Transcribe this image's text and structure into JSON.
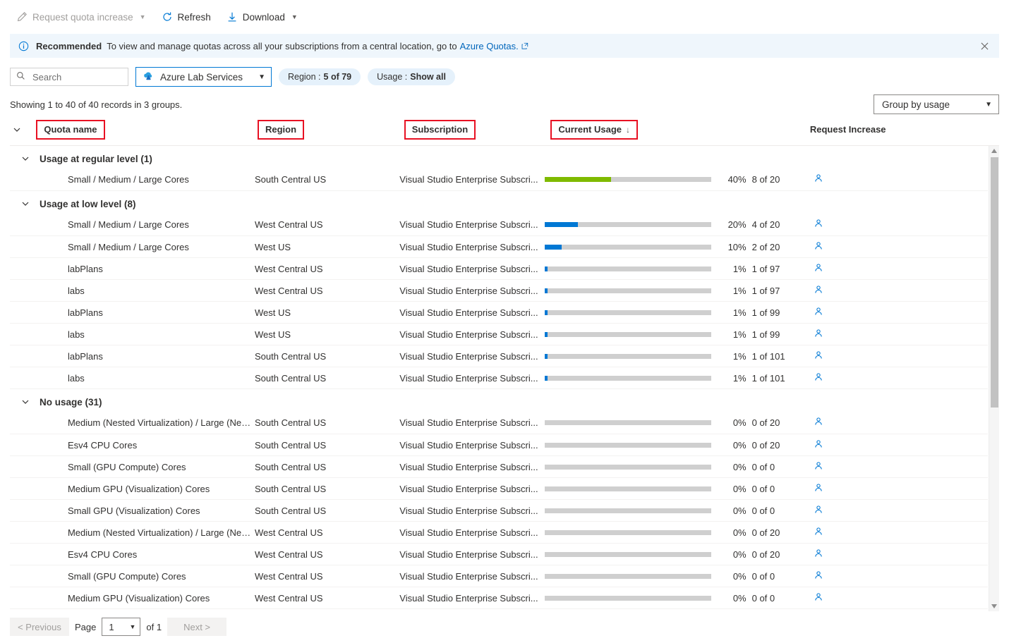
{
  "toolbar": {
    "request_quota_increase": "Request quota increase",
    "refresh": "Refresh",
    "download": "Download"
  },
  "banner": {
    "label": "Recommended",
    "text": "To view and manage quotas across all your subscriptions from a central location, go to",
    "link": "Azure Quotas."
  },
  "filters": {
    "search_placeholder": "Search",
    "search_value": "",
    "provider": "Azure Lab Services",
    "region_pill_label": "Region :",
    "region_pill_value": "5 of 79",
    "usage_pill_label": "Usage :",
    "usage_pill_value": "Show all"
  },
  "summary": {
    "showing": "Showing 1 to 40 of 40 records in 3 groups.",
    "group_by": "Group by usage"
  },
  "columns": {
    "quota_name": "Quota name",
    "region": "Region",
    "subscription": "Subscription",
    "current_usage": "Current Usage",
    "sort_arrow": "↓",
    "request_increase": "Request Increase"
  },
  "colors": {
    "accent": "#0078d4",
    "green": "#7fba00",
    "blue_bar": "#0078d4",
    "track": "#cfcfcf",
    "highlight_box": "#e81123",
    "banner_bg": "#eff6fc",
    "pill_bg": "#e5f1fb"
  },
  "groups": [
    {
      "title": "Usage at regular level (1)",
      "rows": [
        {
          "quota": "Small / Medium / Large Cores",
          "region": "South Central US",
          "subscription": "Visual Studio Enterprise Subscri...",
          "percent": "40%",
          "percent_value": 40,
          "bar_color": "#7fba00",
          "of_value": "8 of 20"
        }
      ]
    },
    {
      "title": "Usage at low level (8)",
      "rows": [
        {
          "quota": "Small / Medium / Large Cores",
          "region": "West Central US",
          "subscription": "Visual Studio Enterprise Subscri...",
          "percent": "20%",
          "percent_value": 20,
          "bar_color": "#0078d4",
          "of_value": "4 of 20"
        },
        {
          "quota": "Small / Medium / Large Cores",
          "region": "West US",
          "subscription": "Visual Studio Enterprise Subscri...",
          "percent": "10%",
          "percent_value": 10,
          "bar_color": "#0078d4",
          "of_value": "2 of 20"
        },
        {
          "quota": "labPlans",
          "region": "West Central US",
          "subscription": "Visual Studio Enterprise Subscri...",
          "percent": "1%",
          "percent_value": 1,
          "bar_color": "#0078d4",
          "of_value": "1 of 97"
        },
        {
          "quota": "labs",
          "region": "West Central US",
          "subscription": "Visual Studio Enterprise Subscri...",
          "percent": "1%",
          "percent_value": 1,
          "bar_color": "#0078d4",
          "of_value": "1 of 97"
        },
        {
          "quota": "labPlans",
          "region": "West US",
          "subscription": "Visual Studio Enterprise Subscri...",
          "percent": "1%",
          "percent_value": 1,
          "bar_color": "#0078d4",
          "of_value": "1 of 99"
        },
        {
          "quota": "labs",
          "region": "West US",
          "subscription": "Visual Studio Enterprise Subscri...",
          "percent": "1%",
          "percent_value": 1,
          "bar_color": "#0078d4",
          "of_value": "1 of 99"
        },
        {
          "quota": "labPlans",
          "region": "South Central US",
          "subscription": "Visual Studio Enterprise Subscri...",
          "percent": "1%",
          "percent_value": 1,
          "bar_color": "#0078d4",
          "of_value": "1 of 101"
        },
        {
          "quota": "labs",
          "region": "South Central US",
          "subscription": "Visual Studio Enterprise Subscri...",
          "percent": "1%",
          "percent_value": 1,
          "bar_color": "#0078d4",
          "of_value": "1 of 101"
        }
      ]
    },
    {
      "title": "No usage (31)",
      "rows": [
        {
          "quota": "Medium (Nested Virtualization) / Large (Nested ...",
          "region": "South Central US",
          "subscription": "Visual Studio Enterprise Subscri...",
          "percent": "0%",
          "percent_value": 0,
          "bar_color": "#0078d4",
          "of_value": "0 of 20"
        },
        {
          "quota": "Esv4 CPU Cores",
          "region": "South Central US",
          "subscription": "Visual Studio Enterprise Subscri...",
          "percent": "0%",
          "percent_value": 0,
          "bar_color": "#0078d4",
          "of_value": "0 of 20"
        },
        {
          "quota": "Small (GPU Compute) Cores",
          "region": "South Central US",
          "subscription": "Visual Studio Enterprise Subscri...",
          "percent": "0%",
          "percent_value": 0,
          "bar_color": "#0078d4",
          "of_value": "0 of 0"
        },
        {
          "quota": "Medium GPU (Visualization) Cores",
          "region": "South Central US",
          "subscription": "Visual Studio Enterprise Subscri...",
          "percent": "0%",
          "percent_value": 0,
          "bar_color": "#0078d4",
          "of_value": "0 of 0"
        },
        {
          "quota": "Small GPU (Visualization) Cores",
          "region": "South Central US",
          "subscription": "Visual Studio Enterprise Subscri...",
          "percent": "0%",
          "percent_value": 0,
          "bar_color": "#0078d4",
          "of_value": "0 of 0"
        },
        {
          "quota": "Medium (Nested Virtualization) / Large (Nested ...",
          "region": "West Central US",
          "subscription": "Visual Studio Enterprise Subscri...",
          "percent": "0%",
          "percent_value": 0,
          "bar_color": "#0078d4",
          "of_value": "0 of 20"
        },
        {
          "quota": "Esv4 CPU Cores",
          "region": "West Central US",
          "subscription": "Visual Studio Enterprise Subscri...",
          "percent": "0%",
          "percent_value": 0,
          "bar_color": "#0078d4",
          "of_value": "0 of 20"
        },
        {
          "quota": "Small (GPU Compute) Cores",
          "region": "West Central US",
          "subscription": "Visual Studio Enterprise Subscri...",
          "percent": "0%",
          "percent_value": 0,
          "bar_color": "#0078d4",
          "of_value": "0 of 0"
        },
        {
          "quota": "Medium GPU (Visualization) Cores",
          "region": "West Central US",
          "subscription": "Visual Studio Enterprise Subscri...",
          "percent": "0%",
          "percent_value": 0,
          "bar_color": "#0078d4",
          "of_value": "0 of 0"
        }
      ]
    }
  ],
  "pagination": {
    "previous": "< Previous",
    "page_label": "Page",
    "page_value": "1",
    "of_label": "of 1",
    "next": "Next >"
  }
}
